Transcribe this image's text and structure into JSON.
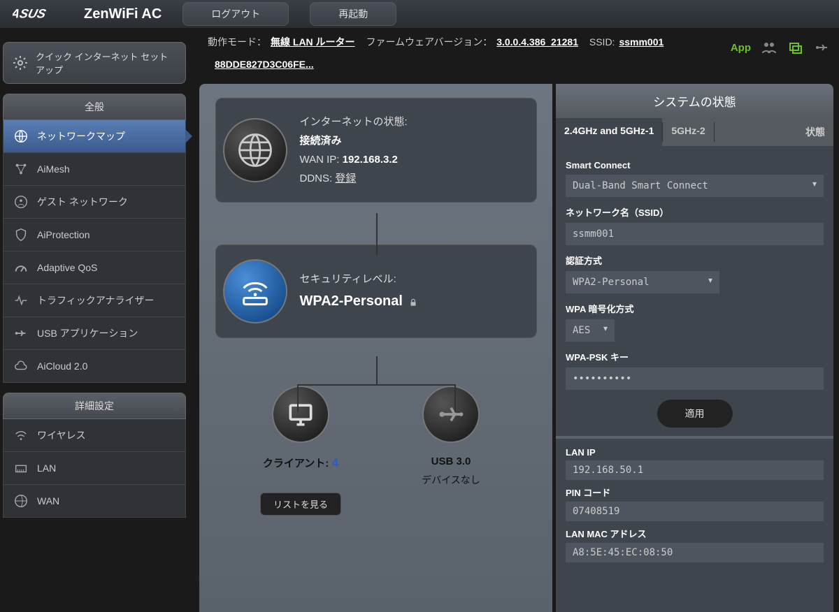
{
  "header": {
    "brand": "ZenWiFi AC",
    "logout": "ログアウト",
    "reboot": "再起動"
  },
  "statusbar": {
    "mode_label": "動作モード：",
    "mode_value": "無線 LAN ルーター",
    "fw_label": "ファームウェアバージョン：",
    "fw_value": "3.0.0.4.386_21281",
    "ssid_label": "SSID:",
    "ssid_value": "ssmm001",
    "mac_snippet": "88DDE827D3C06FE...",
    "app_label": "App"
  },
  "sidebar": {
    "qis": "クイック インターネット セットアップ",
    "general_header": "全般",
    "items": [
      "ネットワークマップ",
      "AiMesh",
      "ゲスト ネットワーク",
      "AiProtection",
      "Adaptive QoS",
      "トラフィックアナライザー",
      "USB アプリケーション",
      "AiCloud 2.0"
    ],
    "advanced_header": "詳細設定",
    "adv_items": [
      "ワイヤレス",
      "LAN",
      "WAN"
    ]
  },
  "main": {
    "internet_label": "インターネットの状態:",
    "internet_status": "接続済み",
    "wan_ip_label": "WAN IP:",
    "wan_ip": "192.168.3.2",
    "ddns_label": "DDNS:",
    "ddns_value": "登録",
    "security_label": "セキュリティレベル:",
    "security_value": "WPA2-Personal",
    "clients_label": "クライアント:",
    "clients_count": "4",
    "clients_list_btn": "リストを見る",
    "usb_label": "USB 3.0",
    "usb_status": "デバイスなし"
  },
  "right": {
    "title": "システムの状態",
    "tabs": [
      "2.4GHz and 5GHz-1",
      "5GHz-2",
      "状態"
    ],
    "smart_connect_label": "Smart Connect",
    "smart_connect_value": "Dual-Band Smart Connect",
    "ssid_label": "ネットワーク名（SSID）",
    "ssid_value": "ssmm001",
    "auth_label": "認証方式",
    "auth_value": "WPA2-Personal",
    "enc_label": "WPA 暗号化方式",
    "enc_value": "AES",
    "psk_label": "WPA-PSK キー",
    "psk_value": "••••••••••",
    "apply": "適用",
    "lan_ip_label": "LAN IP",
    "lan_ip": "192.168.50.1",
    "pin_label": "PIN コード",
    "pin": "07408519",
    "lan_mac_label": "LAN MAC アドレス",
    "lan_mac": "A8:5E:45:EC:08:50"
  }
}
